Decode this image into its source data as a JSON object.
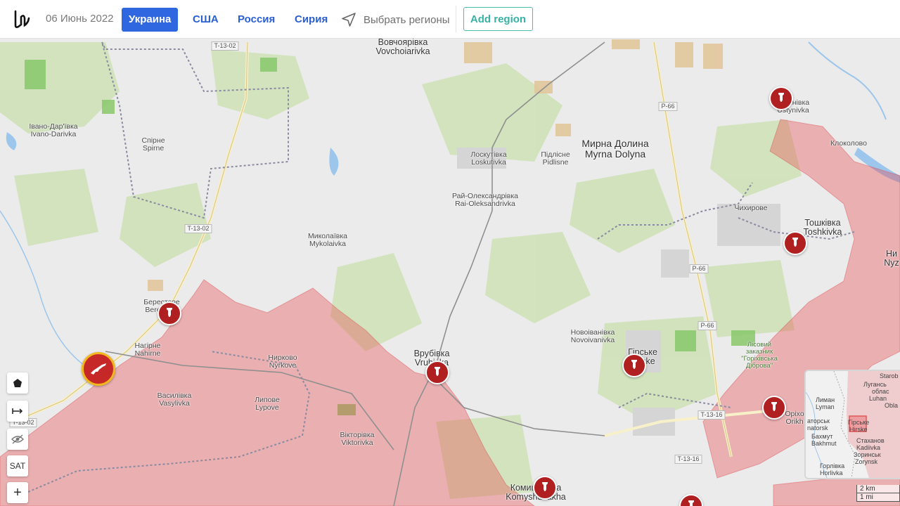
{
  "header": {
    "date": "06 Июнь 2022",
    "tabs": [
      {
        "label": "Украина",
        "active": true
      },
      {
        "label": "США",
        "active": false
      },
      {
        "label": "Россия",
        "active": false
      },
      {
        "label": "Сирия",
        "active": false
      }
    ],
    "select_regions": "Выбрать регионы",
    "add_region": "Add region"
  },
  "map": {
    "places": {
      "vovchoiarivka": [
        "Вовчоярівка",
        "Vovchoiarivka"
      ],
      "ivano_darivka": [
        "Івано-Дар'ївка",
        "Ivano-Darivka"
      ],
      "spirne": [
        "Спірне",
        "Spirne"
      ],
      "loskutivka": [
        "Лоскутівка",
        "Loskutivka"
      ],
      "pidlisne": [
        "Підлісне",
        "Pidlisne"
      ],
      "myrna_dolyna": [
        "Мирна Долина",
        "Myrna Dolyna"
      ],
      "rai_oleksandrivka": [
        "Рай-Олександрівка",
        "Rai-Oleksandrivka"
      ],
      "mykolaivka": [
        "Миколаївка",
        "Mykolaivka"
      ],
      "berestove": [
        "Берестове",
        "Berestove"
      ],
      "nahirne": [
        "Нагірне",
        "Nahirne"
      ],
      "nyrkove": [
        "Нирково",
        "Nyrkove"
      ],
      "vasylivka": [
        "Василівка",
        "Vasylivka"
      ],
      "lypove": [
        "Липове",
        "Lypove"
      ],
      "vrubivka": [
        "Врубівка",
        "Vrubivka"
      ],
      "viktorivka": [
        "Вікторівка",
        "Viktorivka"
      ],
      "novoivanivka": [
        "Новоіванівка",
        "Novoivanivka"
      ],
      "hirske": [
        "Гірське",
        "Hirske"
      ],
      "komyshuvakha": [
        "Комишуваха",
        "Komyshuvakha"
      ],
      "ustynivka": [
        "Устинівка",
        "Ustynivka"
      ],
      "klokolovo": "Клоколово",
      "chykhyrove": "Чихирове",
      "toshkivka": [
        "Тошківка",
        "Toshkivka"
      ],
      "nyzhnie": [
        "Ни",
        "Nyz"
      ],
      "orikhove": [
        "Оріхо",
        "Orikh"
      ],
      "lisovyi": [
        "Лісовий",
        "заказник",
        "\"Горіхівська",
        "Діброва\""
      ]
    },
    "roads": [
      "T-13-02",
      "T-13-02",
      "T-13-02",
      "P-66",
      "P-66",
      "P-66",
      "T-13-16",
      "T-13-16"
    ],
    "markers": [
      "strike",
      "strike",
      "strike",
      "strike",
      "strike",
      "strike",
      "strike",
      "strike",
      "firefight"
    ],
    "controls": {
      "sat": "SAT",
      "zoom_in": "+"
    },
    "minimap": {
      "labels": [
        "Starob",
        "Лугансь",
        "облас",
        "Luhan",
        "Лиман",
        "Lyman",
        "Obla",
        "аторськ",
        "natorsk",
        "Гірське",
        "Hirske",
        "Бахмут",
        "Bakhmut",
        "Стаханов",
        "Kadiivka",
        "Зоринськ",
        "Zorynsk",
        "Горлівка",
        "Horlivka"
      ]
    },
    "scale": {
      "km": "2 km",
      "mi": "1 mi"
    },
    "colors": {
      "occupied": "#e8494e",
      "accent": "#2f67e0",
      "marker": "#b02020"
    }
  }
}
